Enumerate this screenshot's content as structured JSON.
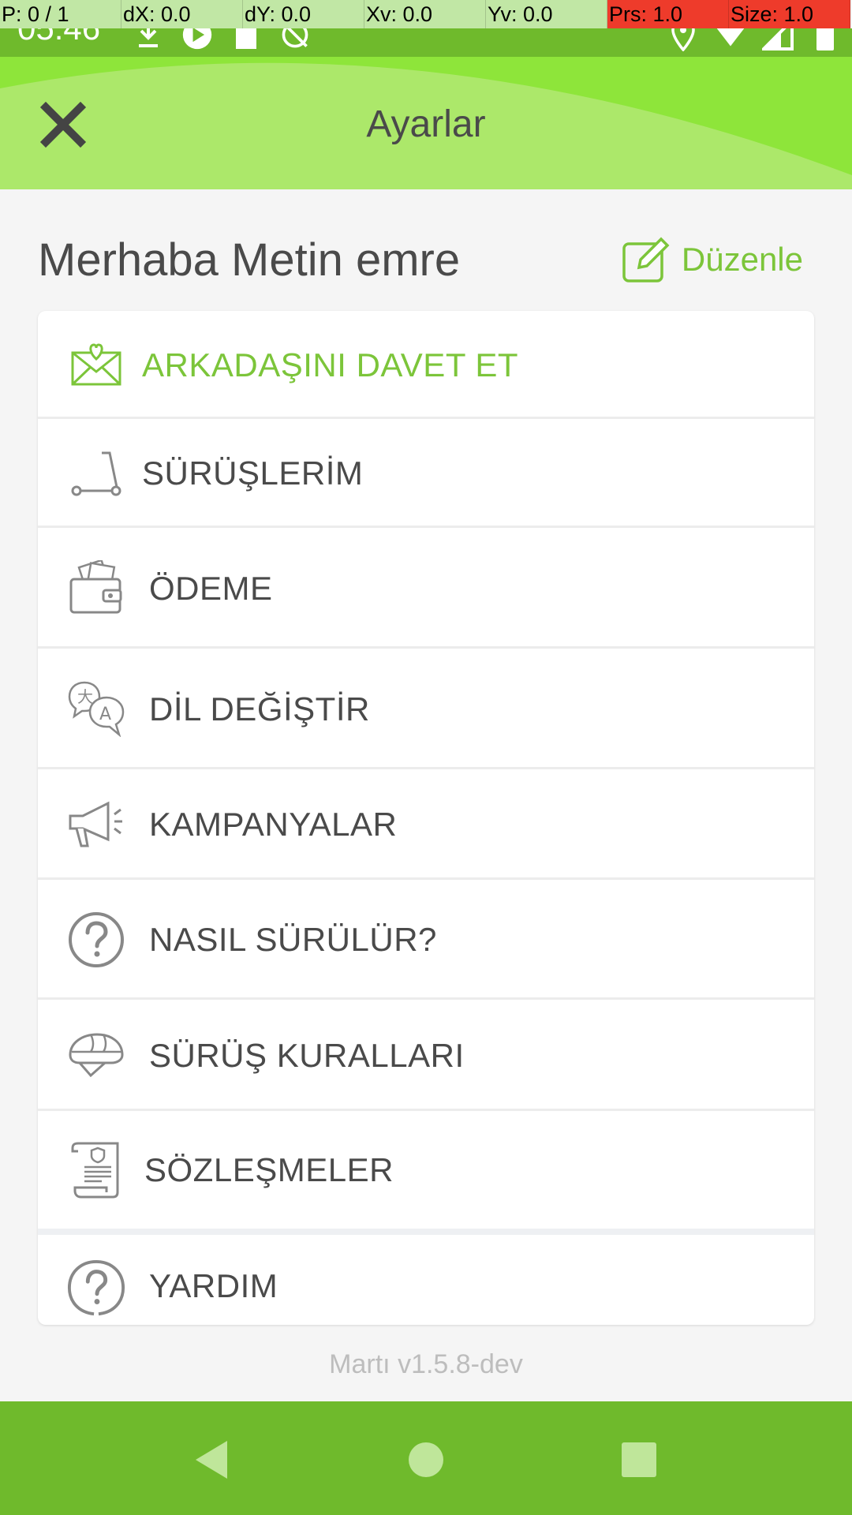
{
  "debug": {
    "cells": [
      "P: 0 / 1",
      "dX: 0.0",
      "dY: 0.0",
      "Xv: 0.0",
      "Yv: 0.0",
      "Prs: 1.0",
      "Size: 1.0"
    ]
  },
  "status_bar": {
    "time": "05:46",
    "left_icons": [
      "download-icon",
      "app-notification-icon",
      "sd-card-icon",
      "no-sync-icon"
    ],
    "right_icons": [
      "location-icon",
      "wifi-icon",
      "signal-icon",
      "battery-icon"
    ]
  },
  "header": {
    "title": "Ayarlar",
    "close_icon": "close-icon"
  },
  "profile": {
    "greeting": "Merhaba Metin emre",
    "edit_label": "Düzenle"
  },
  "menu": {
    "items": [
      {
        "label": "ARKADAŞINI DAVET ET",
        "icon": "invite-mail-icon",
        "highlight": true
      },
      {
        "label": "SÜRÜŞLERİM",
        "icon": "scooter-icon"
      },
      {
        "label": "ÖDEME",
        "icon": "wallet-icon"
      },
      {
        "label": "DİL DEĞİŞTİR",
        "icon": "language-icon"
      },
      {
        "label": "KAMPANYALAR",
        "icon": "megaphone-icon"
      },
      {
        "label": "NASIL SÜRÜLÜR?",
        "icon": "question-circle-icon"
      },
      {
        "label": "SÜRÜŞ KURALLARI",
        "icon": "helmet-icon"
      },
      {
        "label": "SÖZLEŞMELER",
        "icon": "contract-icon"
      },
      {
        "label": "YARDIM",
        "icon": "help-bubble-icon"
      }
    ]
  },
  "version": "Martı v1.5.8-dev",
  "colors": {
    "brand_green": "#8ee53a",
    "status_green": "#6fba2c",
    "accent_text": "#7cc53a"
  }
}
